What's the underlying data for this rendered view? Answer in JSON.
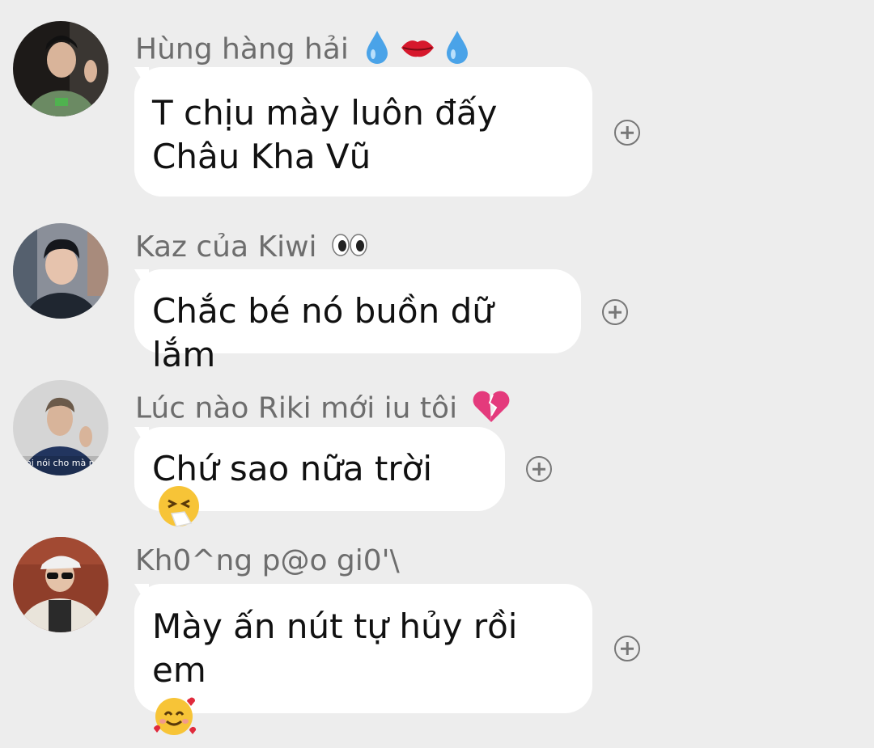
{
  "messages": [
    {
      "sender": "Hùng hàng hải",
      "sender_emojis": [
        "droplet-icon",
        "lips-icon",
        "droplet-icon"
      ],
      "text": "T chịu mày luôn đấy\nChâu Kha Vũ",
      "reaction_icon": "add-reaction-icon"
    },
    {
      "sender": "Kaz của Kiwi",
      "sender_emojis": [
        "eyes-icon"
      ],
      "text": "Chắc bé nó buồn dữ lắm",
      "reaction_icon": "add-reaction-icon"
    },
    {
      "sender": "Lúc nào Riki mới iu tôi",
      "sender_emojis": [
        "broken-heart-icon"
      ],
      "text": "Chứ sao nữa trời",
      "text_emoji": "sneezing-face-icon",
      "avatar_caption": "mi nói cho mà n",
      "reaction_icon": "add-reaction-icon"
    },
    {
      "sender": "Kh0^ng p@o gi0'\\",
      "text": "Mày ấn nút tự hủy rồi em",
      "text_emoji": "smiling-face-with-hearts-icon",
      "reaction_icon": "add-reaction-icon"
    }
  ],
  "colors": {
    "background": "#ededed",
    "bubble": "#ffffff",
    "sender_text": "#6d6d6d",
    "icon": "#777777"
  }
}
